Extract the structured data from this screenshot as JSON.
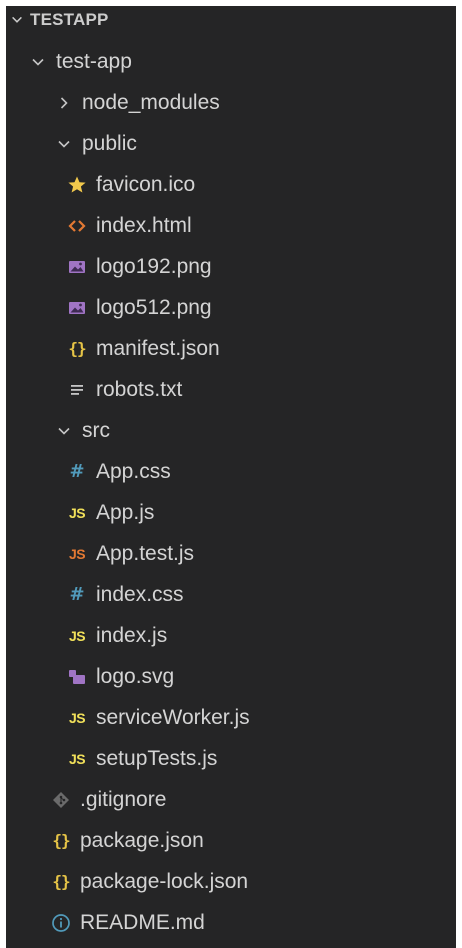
{
  "explorer": {
    "root_label": "TESTAPP",
    "items": [
      {
        "label": "test-app",
        "type": "folder-open"
      },
      {
        "label": "node_modules",
        "type": "folder-closed"
      },
      {
        "label": "public",
        "type": "folder-open"
      },
      {
        "label": "favicon.ico",
        "icon": "star-icon"
      },
      {
        "label": "index.html",
        "icon": "html-icon"
      },
      {
        "label": "logo192.png",
        "icon": "image-icon"
      },
      {
        "label": "logo512.png",
        "icon": "image-icon"
      },
      {
        "label": "manifest.json",
        "icon": "json-icon"
      },
      {
        "label": "robots.txt",
        "icon": "text-lines-icon"
      },
      {
        "label": "src",
        "type": "folder-open"
      },
      {
        "label": "App.css",
        "icon": "css-hash-icon"
      },
      {
        "label": "App.js",
        "icon": "js-icon"
      },
      {
        "label": "App.test.js",
        "icon": "js-test-icon"
      },
      {
        "label": "index.css",
        "icon": "css-hash-icon"
      },
      {
        "label": "index.js",
        "icon": "js-icon"
      },
      {
        "label": "logo.svg",
        "icon": "svg-icon"
      },
      {
        "label": "serviceWorker.js",
        "icon": "js-icon"
      },
      {
        "label": "setupTests.js",
        "icon": "js-icon"
      },
      {
        "label": ".gitignore",
        "icon": "git-icon"
      },
      {
        "label": "package.json",
        "icon": "json-icon"
      },
      {
        "label": "package-lock.json",
        "icon": "json-icon"
      },
      {
        "label": "README.md",
        "icon": "info-icon"
      }
    ]
  },
  "icon_text": {
    "braces": "{}",
    "js": "JS",
    "hash": "#"
  },
  "colors": {
    "background": "#252526",
    "text": "#d4d4d4",
    "star": "#f2c94c",
    "html": "#e37933",
    "image": "#a074c4",
    "json": "#e7c547",
    "css": "#519aba",
    "js": "#f1e05a",
    "js_test": "#e37933",
    "svg": "#a074c4",
    "git": "#6b6b6b",
    "info": "#519aba"
  }
}
